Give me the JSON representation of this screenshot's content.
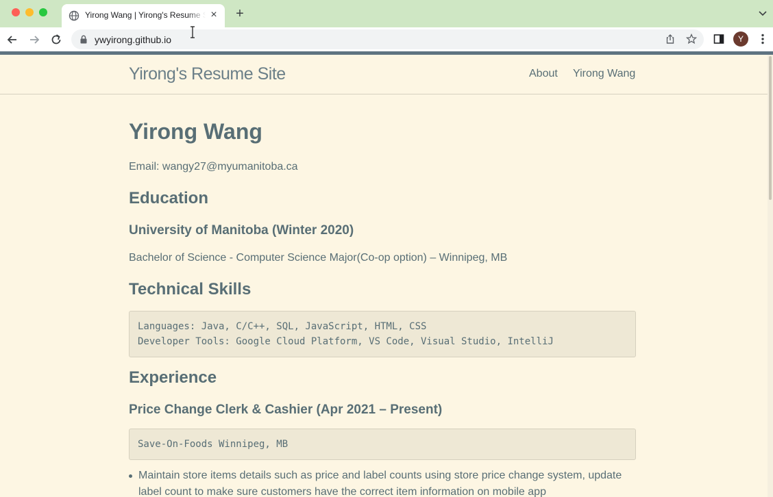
{
  "browser": {
    "tab_title": "Yirong Wang | Yirong's Resume Site",
    "tab_close": "×",
    "new_tab": "+",
    "url": "ywyirong.github.io",
    "avatar_initial": "Y",
    "icons": [
      "globe-icon",
      "back-icon",
      "forward-icon",
      "reload-icon",
      "lock-icon",
      "share-icon",
      "star-icon",
      "sidepanel-icon",
      "menu-icon",
      "chevron-down-icon"
    ]
  },
  "site": {
    "title": "Yirong's Resume Site",
    "nav": [
      "About",
      "Yirong Wang"
    ]
  },
  "resume": {
    "name": "Yirong Wang",
    "email_line": "Email: wangy27@myumanitoba.ca",
    "education_heading": "Education",
    "school": "University of Manitoba (Winter 2020)",
    "degree": "Bachelor of Science - Computer Science Major(Co-op option) – Winnipeg, MB",
    "skills_heading": "Technical Skills",
    "skills": [
      "Languages: Java, C/C++, SQL, JavaScript, HTML, CSS",
      "Developer Tools: Google Cloud Platform, VS Code, Visual Studio, IntelliJ"
    ],
    "experience_heading": "Experience",
    "job_title": "Price Change Clerk & Cashier (Apr 2021 – Present)",
    "job_employer": "Save-On-Foods Winnipeg, MB",
    "job_bullets": [
      "Maintain store items details such as price and label counts using store price change system, update label count to make sure customers have the correct item information on mobile app"
    ]
  },
  "colors": {
    "page_bg": "#fdf6e3",
    "text": "#586e75",
    "code_bg": "#eee8d5",
    "tabstrip": "#cfe7c4"
  }
}
